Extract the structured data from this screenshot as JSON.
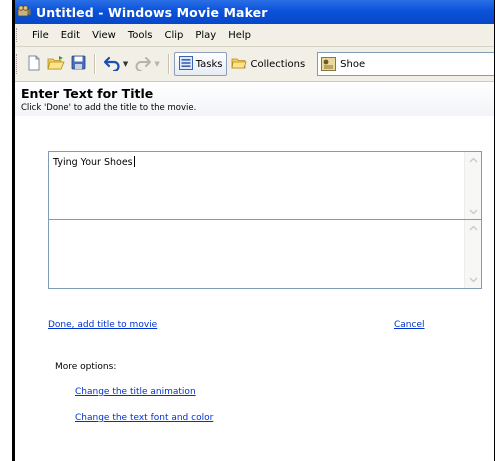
{
  "window": {
    "title": "Untitled - Windows Movie Maker",
    "accent_color": "#0a52d9"
  },
  "menu": {
    "items": [
      "File",
      "Edit",
      "View",
      "Tools",
      "Clip",
      "Play",
      "Help"
    ]
  },
  "toolbar": {
    "new_icon": "new-document-icon",
    "open_icon": "open-folder-icon",
    "save_icon": "save-disk-icon",
    "undo_icon": "undo-icon",
    "redo_icon": "redo-icon",
    "tasks_label": "Tasks",
    "collections_label": "Collections",
    "collection_value": "Shoe"
  },
  "page": {
    "heading": "Enter Text for Title",
    "subheading": "Click 'Done' to add the title to the movie."
  },
  "title_text": {
    "line1": "Tying Your Shoes",
    "line2": ""
  },
  "actions": {
    "done_label": "Done, add title to movie",
    "cancel_label": "Cancel"
  },
  "more_options": {
    "label": "More options:",
    "animation_link": "Change the title animation",
    "font_link": "Change the text font and color"
  }
}
